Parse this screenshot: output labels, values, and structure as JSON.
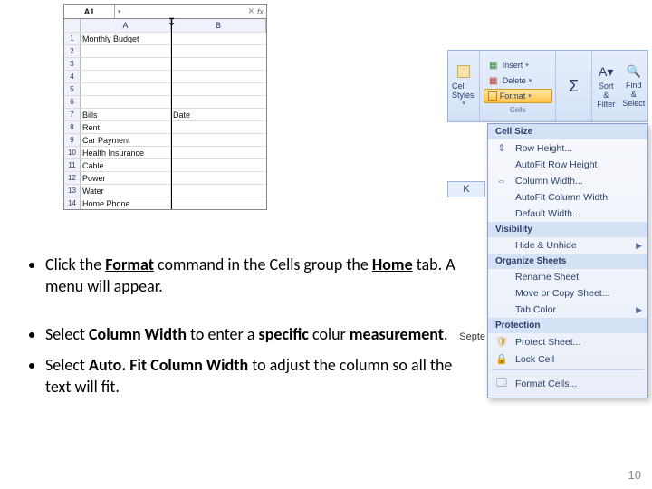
{
  "sheet": {
    "namebox": "A1",
    "columns": [
      "A",
      "B"
    ],
    "rows": [
      {
        "n": "1",
        "a": "Monthly Budget",
        "b": ""
      },
      {
        "n": "2",
        "a": "",
        "b": ""
      },
      {
        "n": "3",
        "a": "",
        "b": ""
      },
      {
        "n": "4",
        "a": "",
        "b": ""
      },
      {
        "n": "5",
        "a": "",
        "b": ""
      },
      {
        "n": "6",
        "a": "",
        "b": ""
      },
      {
        "n": "7",
        "a": "Bills",
        "b": "Date"
      },
      {
        "n": "8",
        "a": "Rent",
        "b": ""
      },
      {
        "n": "9",
        "a": "Car Payment",
        "b": ""
      },
      {
        "n": "10",
        "a": "Health Insurance",
        "b": ""
      },
      {
        "n": "11",
        "a": "Cable",
        "b": ""
      },
      {
        "n": "12",
        "a": "Power",
        "b": ""
      },
      {
        "n": "13",
        "a": "Water",
        "b": ""
      },
      {
        "n": "14",
        "a": "Home Phone",
        "b": ""
      }
    ]
  },
  "ribbon": {
    "cell_styles": "Cell Styles",
    "insert": "Insert",
    "delete": "Delete",
    "format": "Format",
    "cells_label": "Cells",
    "sort_filter": "Sort & Filter",
    "find_select": "Find & Select"
  },
  "k_header": "K",
  "september_fragment": "Septe",
  "format_menu": {
    "sections": {
      "cell_size": "Cell Size",
      "visibility": "Visibility",
      "organize_sheets": "Organize Sheets",
      "protection": "Protection"
    },
    "items": {
      "row_height": "Row Height...",
      "autofit_row": "AutoFit Row Height",
      "column_width": "Column Width...",
      "autofit_col": "AutoFit Column Width",
      "default_width": "Default Width...",
      "hide_unhide": "Hide & Unhide",
      "rename_sheet": "Rename Sheet",
      "move_copy": "Move or Copy Sheet...",
      "tab_color": "Tab Color",
      "protect_sheet": "Protect Sheet...",
      "lock_cell": "Lock Cell",
      "format_cells": "Format Cells..."
    }
  },
  "instructions": {
    "b1_pre": "Click the ",
    "b1_format": "Format",
    "b1_mid": " command in the Cells group the ",
    "b1_home": "Home",
    "b1_post": " tab. A menu will appear.",
    "b2_pre": "Select ",
    "b2_cw": "Column Width",
    "b2_mid": " to enter a ",
    "b2_specific": "specific",
    "b2_mid2": " colur ",
    "b2_meas": "measurement",
    "b2_post": ".",
    "b3_pre": "Select ",
    "b3_af": "Auto. Fit Column Width",
    "b3_post": " to adjust the column so all the text will fit."
  },
  "page_number": "10"
}
